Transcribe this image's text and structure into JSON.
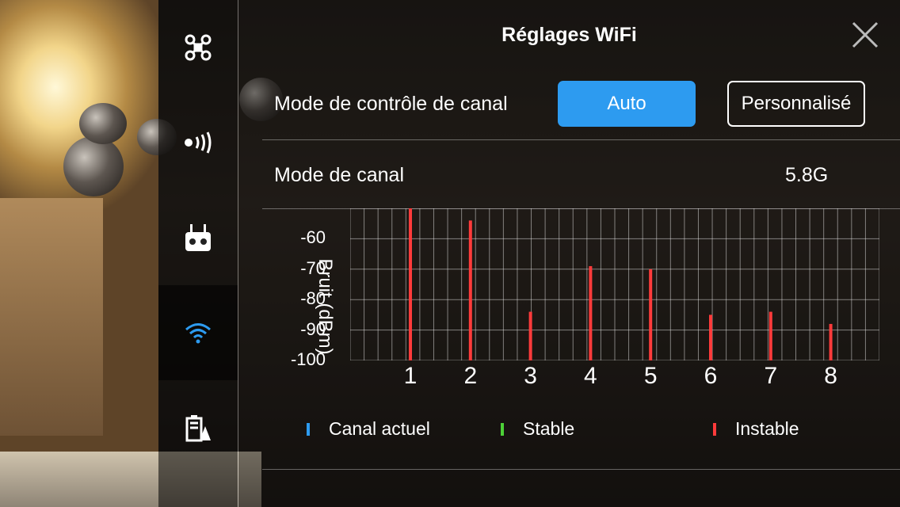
{
  "sidebar": {
    "items": [
      {
        "icon": "aircraft-icon",
        "active": false
      },
      {
        "icon": "remote-signal-icon",
        "active": false
      },
      {
        "icon": "remote-controller-icon",
        "active": false
      },
      {
        "icon": "wifi-icon",
        "active": true
      },
      {
        "icon": "battery-icon",
        "active": false
      }
    ]
  },
  "header": {
    "title": "Réglages WiFi"
  },
  "channel_control": {
    "label": "Mode de contrôle de canal",
    "auto_label": "Auto",
    "custom_label": "Personnalisé",
    "selected": "Auto"
  },
  "channel_mode": {
    "label": "Mode de canal",
    "value": "5.8G"
  },
  "colors": {
    "accent": "#2d9bf0",
    "current": "#2d9bf0",
    "stable": "#4cd137",
    "unstable": "#ff3b3b"
  },
  "chart_data": {
    "type": "bar",
    "ylabel": "Bruit (dBm)",
    "ylim": [
      -100,
      -50
    ],
    "yticks": [
      -60,
      -70,
      -80,
      -90,
      -100
    ],
    "categories": [
      "1",
      "2",
      "3",
      "4",
      "5",
      "6",
      "7",
      "8"
    ],
    "values": [
      -50,
      -54,
      -84,
      -69,
      -70,
      -85,
      -84,
      -88
    ],
    "status": [
      "unstable",
      "unstable",
      "unstable",
      "unstable",
      "unstable",
      "unstable",
      "unstable",
      "unstable"
    ],
    "grid": true,
    "legend": [
      {
        "label": "Canal actuel",
        "status": "current"
      },
      {
        "label": "Stable",
        "status": "stable"
      },
      {
        "label": "Instable",
        "status": "unstable"
      }
    ]
  }
}
